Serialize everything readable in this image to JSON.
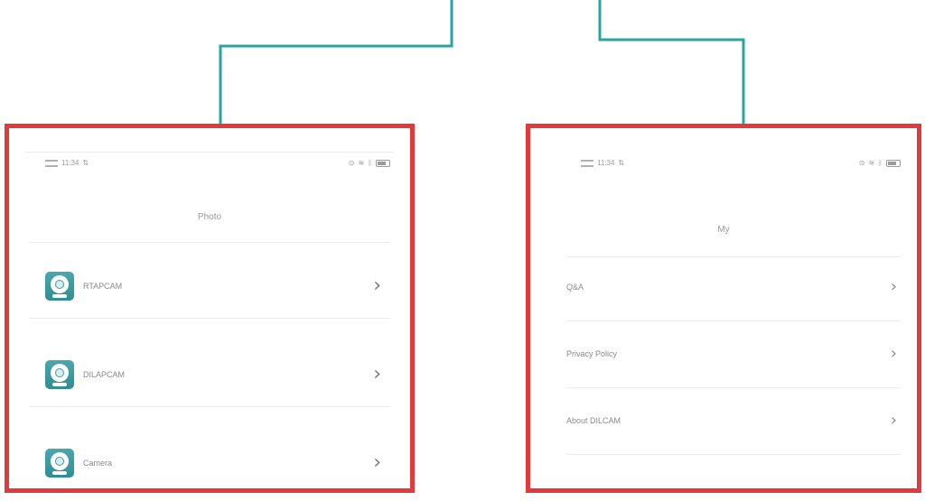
{
  "photo_screen": {
    "status": {
      "time": "11:34",
      "battery_level": 0.6
    },
    "title": "Photo",
    "items": [
      {
        "label": "RTAPCAM"
      },
      {
        "label": "DILAPCAM"
      },
      {
        "label": "Camera"
      }
    ]
  },
  "my_screen": {
    "status": {
      "time": "11:34",
      "battery_level": 0.6
    },
    "title": "My",
    "items": [
      {
        "label": "Q&A"
      },
      {
        "label": "Privacy Policy"
      },
      {
        "label": "About DILCAM"
      }
    ]
  },
  "colors": {
    "highlight_border": "#e23a3a",
    "connector": "#2aa3a3",
    "app_icon": "#3b9aa1"
  }
}
